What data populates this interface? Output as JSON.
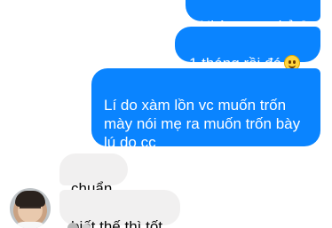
{
  "messages": [
    {
      "id": "msg1",
      "direction": "outgoing",
      "text": "Nhờn cmm hả ?"
    },
    {
      "id": "msg2",
      "direction": "outgoing",
      "text": "1 tháng rồi đó",
      "emoji": "slightly-smiling-face-icon"
    },
    {
      "id": "msg3",
      "direction": "outgoing",
      "text": "Lí do xàm lồn vc muốn trốn\nmày nói mẹ ra muốn trốn bày\nlú do cc"
    },
    {
      "id": "msg4",
      "direction": "incoming",
      "text": "chuẩn"
    },
    {
      "id": "msg5",
      "direction": "incoming",
      "text": "biết thế thì tốt"
    }
  ],
  "colors": {
    "outgoing_bubble": "#0a84ff",
    "incoming_bubble": "#f1f0f0",
    "background": "#ffffff"
  }
}
